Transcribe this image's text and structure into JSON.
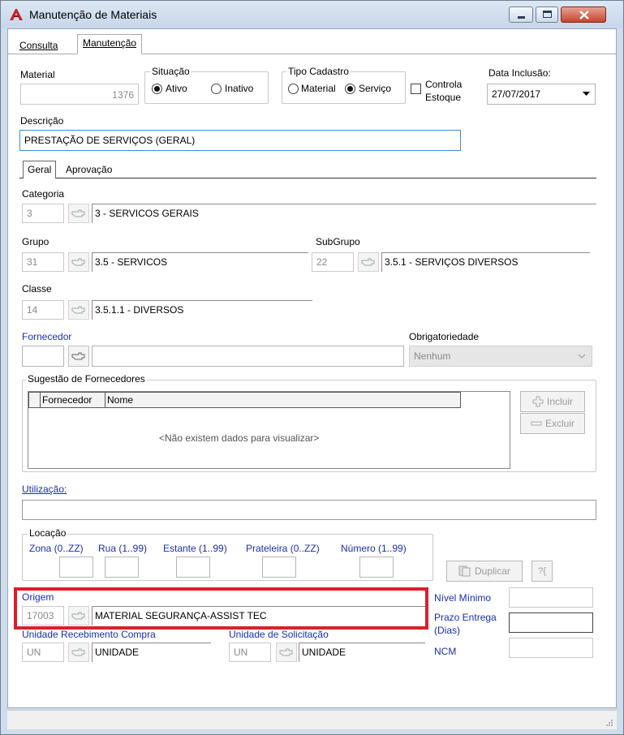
{
  "window": {
    "title": "Manutenção de Materiais"
  },
  "tabs": {
    "consulta": "Consulta",
    "manutencao": "Manutenção"
  },
  "material": {
    "label": "Material",
    "value": "1376"
  },
  "situacao": {
    "label": "Situação",
    "ativo": "Ativo",
    "inativo": "Inativo",
    "selected": "Ativo"
  },
  "tipo_cadastro": {
    "label": "Tipo Cadastro",
    "material": "Material",
    "servico": "Serviço",
    "selected": "Serviço"
  },
  "controla_estoque": {
    "line1": "Controla",
    "line2": "Estoque",
    "checked": false
  },
  "data_inclusao": {
    "label": "Data Inclusão:",
    "value": "27/07/2017"
  },
  "descricao": {
    "label": "Descrição",
    "value": "PRESTAÇÃO DE SERVIÇOS (GERAL)"
  },
  "subtabs": {
    "geral": "Geral",
    "aprovacao": "Aprovação"
  },
  "categoria": {
    "label": "Categoria",
    "code": "3",
    "desc": "3 - SERVICOS GERAIS"
  },
  "grupo": {
    "label": "Grupo",
    "code": "31",
    "desc": "3.5 - SERVICOS"
  },
  "subgrupo": {
    "label": "SubGrupo",
    "code": "22",
    "desc": "3.5.1 - SERVIÇOS DIVERSOS"
  },
  "classe": {
    "label": "Classe",
    "code": "14",
    "desc": "3.5.1.1 - DIVERSOS"
  },
  "fornecedor": {
    "label": "Fornecedor",
    "code": "",
    "desc": ""
  },
  "obrigatoriedade": {
    "label": "Obrigatoriedade",
    "value": "Nenhum"
  },
  "sugestao": {
    "label": "Sugestão de Fornecedores",
    "columns": [
      "Fornecedor",
      "Nome"
    ],
    "empty": "<Não existem dados para visualizar>",
    "incluir": "Incluir",
    "excluir": "Excluir"
  },
  "utilizacao": {
    "label": "Utilização:",
    "value": ""
  },
  "locacao": {
    "label": "Locação",
    "zona": "Zona (0..ZZ)",
    "rua": "Rua (1..99)",
    "estante": "Estante (1..99)",
    "prateleira": "Prateleira (0..ZZ)",
    "numero": "Número (1..99)"
  },
  "duplicar": "Duplicar",
  "origem": {
    "label": "Origem",
    "code": "17003",
    "desc": "MATERIAL SEGURANÇA-ASSIST TEC"
  },
  "nivel_minimo": {
    "label": "Nível Mínimo",
    "value": ""
  },
  "prazo_entrega": {
    "line1": "Prazo Entrega",
    "line2": "(Dias)",
    "value": ""
  },
  "unidade_recebimento": {
    "label": "Unidade Recebimento Compra",
    "code": "UN",
    "desc": "UNIDADE"
  },
  "unidade_solicitacao": {
    "label": "Unidade de Solicitação",
    "code": "UN",
    "desc": "UNIDADE"
  },
  "ncm": {
    "label": "NCM",
    "value": ""
  },
  "colors": {
    "label_blue": "#1a2fb0",
    "highlight_red": "#d9202a",
    "nav_blue": "#1f5fd0"
  }
}
